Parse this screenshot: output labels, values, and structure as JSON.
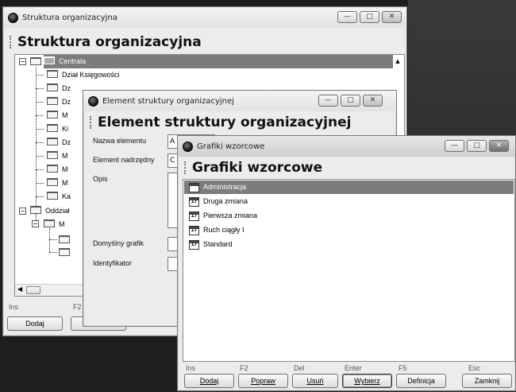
{
  "win1": {
    "title": "Struktura organizacyjna",
    "header": "Struktura organizacyjna",
    "tree": [
      {
        "label": "Centrala",
        "selected": true
      },
      {
        "label": "Dział Księgowości"
      },
      {
        "label": "Dz"
      },
      {
        "label": "Dz"
      },
      {
        "label": "M"
      },
      {
        "label": "Ki"
      },
      {
        "label": "Dz"
      },
      {
        "label": "M"
      },
      {
        "label": "M"
      },
      {
        "label": "M"
      },
      {
        "label": "Ka"
      },
      {
        "label": "Oddział"
      },
      {
        "label": "M"
      }
    ],
    "key_ins": "Ins",
    "key_f2": "F2",
    "btn_add": "Dodaj"
  },
  "win2": {
    "title": "Element struktury organizacyjnej",
    "header": "Element struktury organizacyjnej",
    "lbl_name": "Nazwa elementu",
    "lbl_parent": "Element nadrzędny",
    "lbl_desc": "Opis",
    "lbl_schedule": "Domyślny grafik",
    "lbl_id": "Identyfikator",
    "name_value": "A",
    "parent_value": "C"
  },
  "win3": {
    "title": "Grafiki wzorcowe",
    "header": "Grafiki wzorcowe",
    "items": [
      {
        "label": "Administracja",
        "selected": true
      },
      {
        "label": "Druga zmiana"
      },
      {
        "label": "Pierwsza zmiana"
      },
      {
        "label": "Ruch ciągły I"
      },
      {
        "label": "Standard"
      }
    ],
    "icon_glyph": "17",
    "keys": {
      "ins": "Ins",
      "f2": "F2",
      "del": "Del",
      "enter": "Enter",
      "f5": "F5",
      "esc": "Esc"
    },
    "buttons": {
      "add": "Dodaj",
      "edit": "Popraw",
      "delete": "Usuń",
      "choose": "Wybierz",
      "definition": "Definicja",
      "close": "Zamknij"
    }
  },
  "window_controls": {
    "minimize": "—",
    "maximize": "□",
    "close": "✕"
  }
}
